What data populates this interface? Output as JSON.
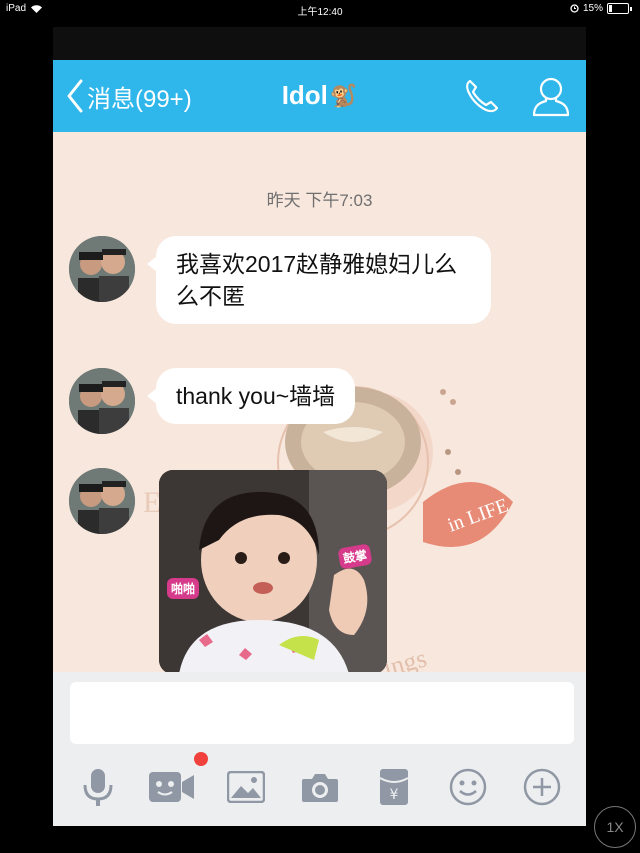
{
  "status_bar": {
    "device": "iPad",
    "time": "上午12:40",
    "battery": "15%"
  },
  "nav": {
    "back_label": "消息(99+)",
    "title": "Idol",
    "title_emoji": "🐒",
    "call_icon": "phone-icon",
    "profile_icon": "person-icon"
  },
  "chat": {
    "timestamp": "昨天 下午7:03",
    "messages": [
      {
        "type": "text",
        "text": "我喜欢2017赵静雅媳妇儿么么不匿"
      },
      {
        "type": "text",
        "text": "thank you~墙墙"
      },
      {
        "type": "image",
        "tag_left": "啪啪",
        "tag_right": "鼓掌"
      }
    ]
  },
  "input": {
    "placeholder": "",
    "value": ""
  },
  "toolbar": {
    "items": [
      "microphone-icon",
      "video-icon",
      "image-icon",
      "camera-icon",
      "red-packet-icon",
      "emoji-icon",
      "plus-icon"
    ],
    "accent": "#2fb6ea",
    "badge_color": "#f0413c"
  },
  "playback": {
    "speed": "1X"
  }
}
